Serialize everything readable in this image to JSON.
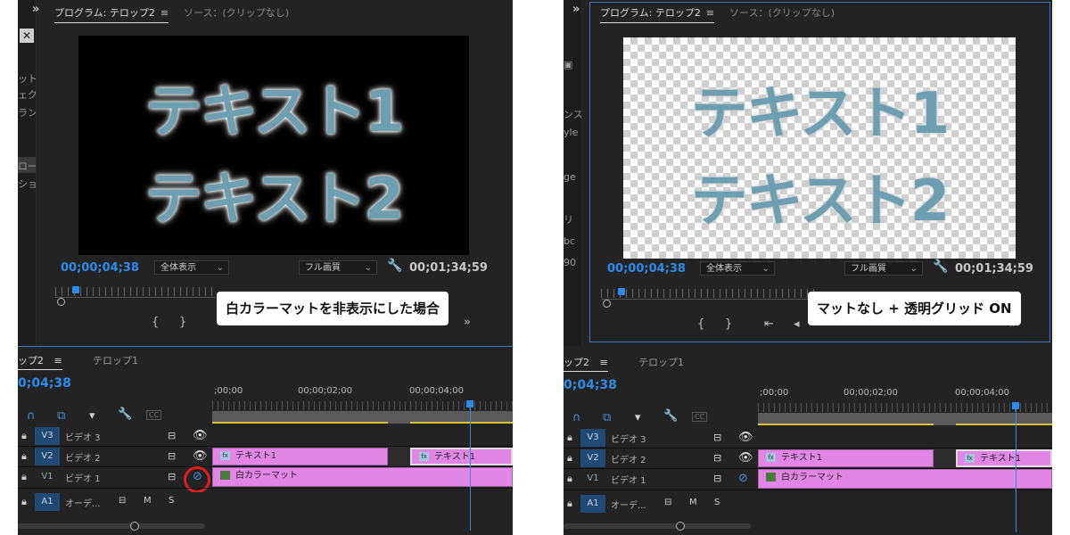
{
  "left": {
    "tab_program": "プログラム: テロップ2",
    "tab_program_menu": "≡",
    "tab_source": "ソース：(クリップなし)",
    "expand_icon": "»",
    "close_icon": "✕",
    "video_text_1": "テキスト1",
    "video_text_2": "テキスト2",
    "timecode_current": "00;00;04;38",
    "zoom_select": "全体表示",
    "quality_select": "フル画質",
    "timecode_duration": "00;01;34;59",
    "overlay_label": "白カラーマットを非表示にした場合",
    "strip_fragments": [
      "ット",
      "ェクト",
      "ランジシ",
      "",
      "ロー",
      "ション"
    ]
  },
  "right": {
    "tab_program": "プログラム: テロップ2",
    "tab_program_menu": "≡",
    "tab_source": "ソース：(クリップなし)",
    "expand_icon": "»",
    "video_text_1": "テキスト1",
    "video_text_2": "テキスト2",
    "timecode_current": "00;00;04;38",
    "zoom_select": "全体表示",
    "quality_select": "フル画質",
    "timecode_duration": "00;01;34;59",
    "overlay_label": "マットなし + 透明グリッド ON",
    "strip_fragments": [
      "ンス",
      "yle",
      "ge",
      "リ",
      "bc",
      "90"
    ]
  },
  "timeline": {
    "tab_active": "ップ2",
    "tab_menu": "≡",
    "tab_other": "テロップ1",
    "timecode": "0;04;38",
    "ruler_labels": [
      ";00;00",
      "00;00;02;00",
      "00;00;04;00"
    ],
    "tracks": [
      {
        "id": "V3",
        "label": "ビデオ 3"
      },
      {
        "id": "V2",
        "label": "ビデオ 2"
      },
      {
        "id": "V1",
        "label": "ビデオ 1"
      },
      {
        "id": "A1",
        "label": "オーデ..."
      }
    ],
    "clip_text1": "テキスト1",
    "clip_text1b": "テキスト1",
    "clip_matte": "白カラーマット",
    "fx_label": "fx",
    "audio_m": "M",
    "audio_s": "S",
    "cc_label": "CC"
  }
}
